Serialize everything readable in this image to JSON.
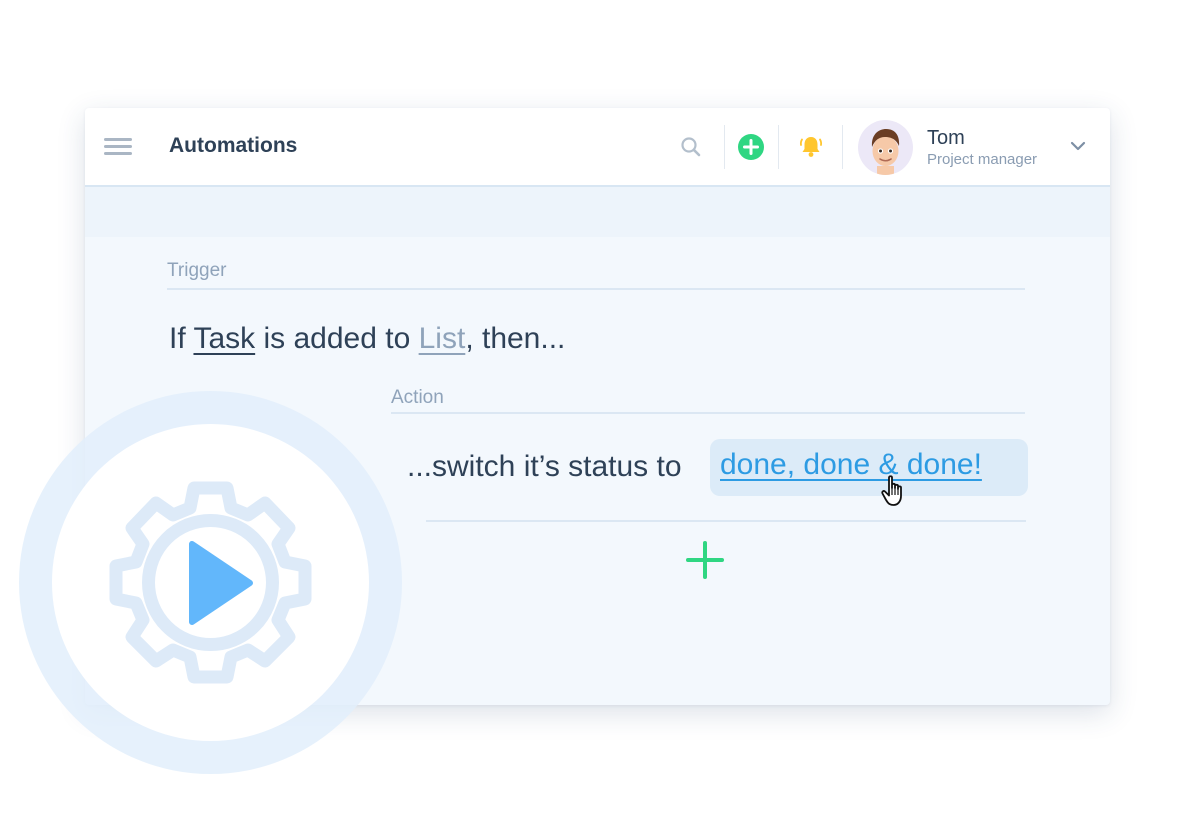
{
  "header": {
    "title": "Automations",
    "icons": {
      "menu": "hamburger-icon",
      "search": "search-icon",
      "add": "plus-circle-icon",
      "notifications": "bell-icon",
      "dropdown": "chevron-down-icon"
    },
    "user": {
      "name": "Tom",
      "role": "Project manager"
    },
    "colors": {
      "add": "#2fd682",
      "bell": "#ffc62e"
    }
  },
  "trigger": {
    "label": "Trigger",
    "prefix": "If",
    "subject": "Task",
    "middle": "is added to",
    "target": "List",
    "suffix": ", then..."
  },
  "action": {
    "label": "Action",
    "prefix": "...switch it’s status to",
    "status": "done, done & done!",
    "add_icon": "plus-icon"
  },
  "badge": {
    "icon": "gear-play-icon"
  },
  "colors": {
    "accent": "#2d9be3",
    "green": "#2fd682",
    "text": "#2e4157",
    "muted": "#8fa3ba"
  }
}
